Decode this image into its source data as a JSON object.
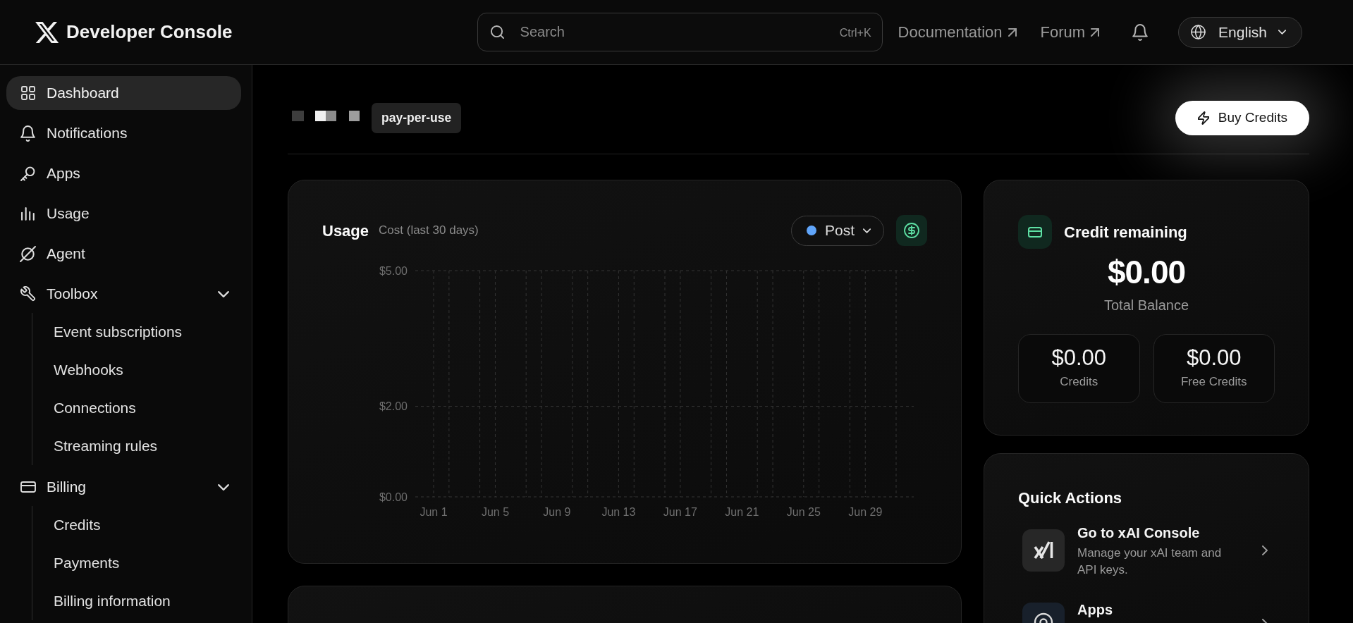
{
  "header": {
    "title": "Developer Console",
    "search": {
      "placeholder": "Search",
      "shortcut": "Ctrl+K"
    },
    "links": [
      {
        "label": "Documentation",
        "external": true
      },
      {
        "label": "Forum",
        "external": true
      }
    ],
    "language": "English"
  },
  "sidebar": {
    "items": [
      {
        "label": "Dashboard",
        "selected": true
      },
      {
        "label": "Notifications",
        "selected": false
      },
      {
        "label": "Apps",
        "selected": false
      },
      {
        "label": "Usage",
        "selected": false
      },
      {
        "label": "Agent",
        "selected": false
      },
      {
        "label": "Toolbox",
        "selected": false,
        "expanded": true,
        "children": [
          {
            "label": "Event subscriptions",
            "selected": false
          },
          {
            "label": "Webhooks",
            "selected": false
          },
          {
            "label": "Connections",
            "selected": false
          },
          {
            "label": "Streaming rules",
            "selected": false
          }
        ]
      },
      {
        "label": "Billing",
        "selected": false,
        "expanded": true,
        "children": [
          {
            "label": "Credits",
            "selected": false
          },
          {
            "label": "Payments",
            "selected": false
          },
          {
            "label": "Billing information",
            "selected": false
          }
        ]
      }
    ]
  },
  "account": {
    "plan": "pay-per-use",
    "buy_button": "Buy Credits"
  },
  "usage": {
    "title": "Usage",
    "subtitle": "Cost (last 30 days)",
    "filter": {
      "label": "Post",
      "color": "#60a5fa"
    },
    "chart_data": {
      "type": "bar",
      "grid": true,
      "categories": [
        "Jun 1",
        null,
        null,
        null,
        "Jun 5",
        null,
        null,
        null,
        "Jun 9",
        null,
        null,
        null,
        "Jun 13",
        null,
        null,
        null,
        "Jun 17",
        null,
        null,
        null,
        "Jun 21",
        null,
        null,
        null,
        "Jun 25",
        null,
        null,
        null,
        "Jun 29",
        null,
        null
      ],
      "ylim": [
        0,
        5
      ],
      "yticks": [
        {
          "value": 0,
          "label": "$0.00"
        },
        {
          "value": 2,
          "label": "$2.00"
        },
        {
          "value": 5,
          "label": "$5.00"
        }
      ]
    }
  },
  "credit": {
    "title": "Credit remaining",
    "total": "$0.00",
    "total_label": "Total Balance",
    "breakdown": [
      {
        "amount": "$0.00",
        "label": "Credits"
      },
      {
        "amount": "$0.00",
        "label": "Free Credits"
      }
    ]
  },
  "quick_actions": {
    "title": "Quick Actions",
    "items": [
      {
        "title": "Go to xAI Console",
        "description": "Manage your xAI team and API keys."
      },
      {
        "title": "Apps"
      }
    ]
  }
}
